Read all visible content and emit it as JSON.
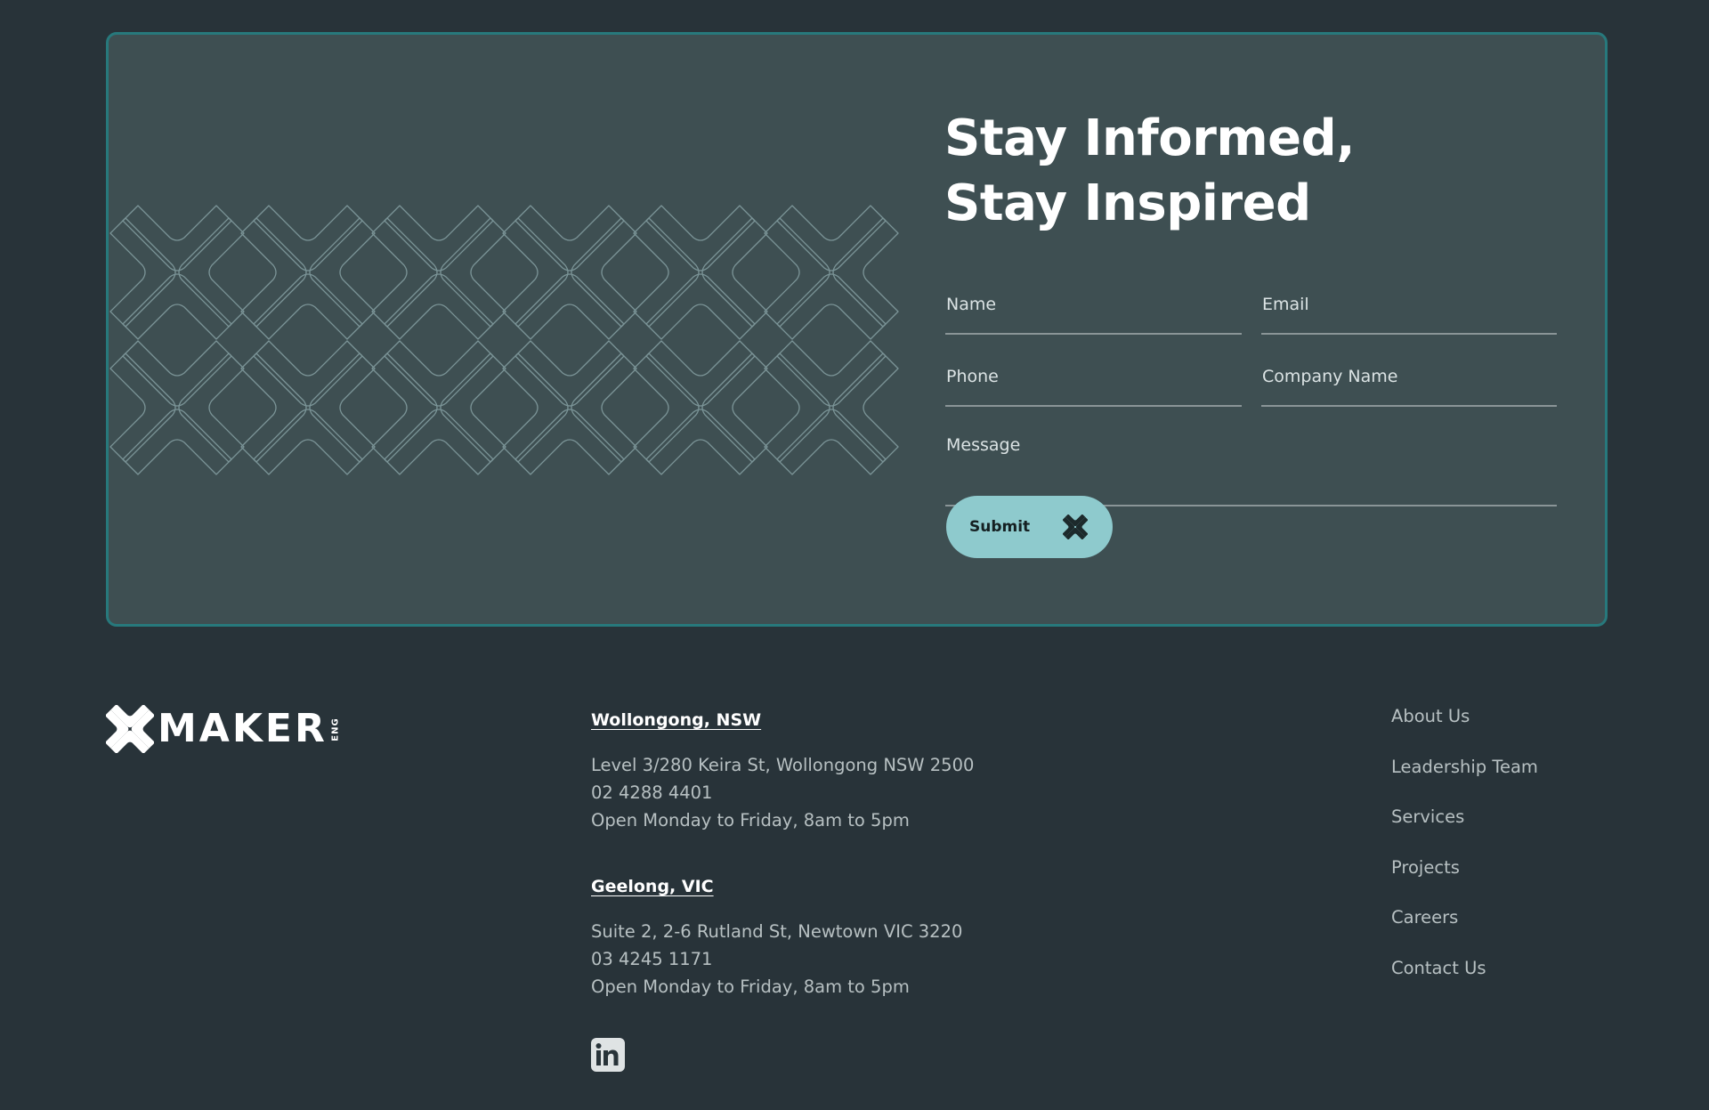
{
  "colors": {
    "page_background": "#283339",
    "card_background": "#3e4f52",
    "card_border": "#27797c",
    "button_background": "#8ecacd",
    "pattern_stroke": "#7b9497",
    "muted_text": "#b7c0c2"
  },
  "signup": {
    "heading_line1": "Stay Informed,",
    "heading_line2": "Stay Inspired",
    "fields": {
      "name": {
        "placeholder": "Name",
        "value": ""
      },
      "email": {
        "placeholder": "Email",
        "value": ""
      },
      "phone": {
        "placeholder": "Phone",
        "value": ""
      },
      "company": {
        "placeholder": "Company Name",
        "value": ""
      },
      "message": {
        "placeholder": "Message",
        "value": ""
      }
    },
    "submit_label": "Submit",
    "submit_icon": "maker-x-icon",
    "background_pattern_icon": "maker-x-pattern"
  },
  "footer": {
    "logo": {
      "mark_icon": "maker-x-icon",
      "wordmark": "MAKER",
      "suffix": "ENG"
    },
    "offices": [
      {
        "city": "Wollongong, NSW",
        "address": "Level 3/280 Keira St, Wollongong NSW 2500",
        "phone": "02 4288 4401",
        "hours": "Open Monday to Friday, 8am to 5pm"
      },
      {
        "city": "Geelong, VIC",
        "address": "Suite 2, 2-6 Rutland St, Newtown VIC 3220",
        "phone": "03 4245 1171",
        "hours": "Open Monday to Friday, 8am to 5pm"
      }
    ],
    "social": [
      {
        "name": "LinkedIn",
        "icon": "linkedin-icon"
      }
    ],
    "nav": [
      {
        "label": "About Us"
      },
      {
        "label": "Leadership Team"
      },
      {
        "label": "Services"
      },
      {
        "label": "Projects"
      },
      {
        "label": "Careers"
      },
      {
        "label": "Contact Us"
      }
    ]
  }
}
